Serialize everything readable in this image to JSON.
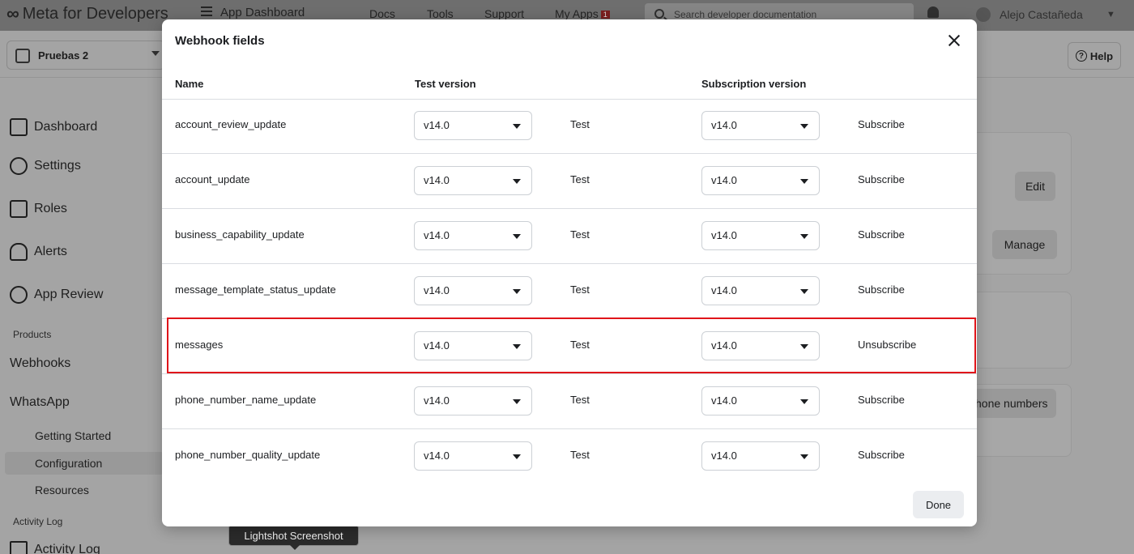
{
  "topbar": {
    "brand": "Meta for Developers",
    "app_dashboard": "App Dashboard",
    "nav": [
      "Docs",
      "Tools",
      "Support",
      "My Apps"
    ],
    "my_apps_badge": "1",
    "search_placeholder": "Search developer documentation",
    "user_name": "Alejo Castañeda"
  },
  "subbar": {
    "app_name": "Pruebas 2",
    "help_label": "Help"
  },
  "sidebar": {
    "items": [
      {
        "label": "Dashboard",
        "icon": "home-icon"
      },
      {
        "label": "Settings",
        "icon": "gear-icon"
      },
      {
        "label": "Roles",
        "icon": "roles-icon"
      },
      {
        "label": "Alerts",
        "icon": "bell-icon"
      },
      {
        "label": "App Review",
        "icon": "shield-check-icon"
      }
    ],
    "products_label": "Products",
    "webhooks": "Webhooks",
    "whatsapp": "WhatsApp",
    "sub_items": [
      "Getting Started",
      "Configuration",
      "Resources"
    ],
    "activity_section": "Activity Log",
    "activity_item": "Activity Log"
  },
  "background": {
    "edit_label": "Edit",
    "manage_label": "Manage",
    "phone_numbers_label": "hone numbers"
  },
  "modal": {
    "title": "Webhook fields",
    "columns": {
      "name": "Name",
      "test_version": "Test version",
      "subscription_version": "Subscription version"
    },
    "rows": [
      {
        "name": "account_review_update",
        "test_version": "v14.0",
        "test_label": "Test",
        "subscription_version": "v14.0",
        "action": "Subscribe"
      },
      {
        "name": "account_update",
        "test_version": "v14.0",
        "test_label": "Test",
        "subscription_version": "v14.0",
        "action": "Subscribe"
      },
      {
        "name": "business_capability_update",
        "test_version": "v14.0",
        "test_label": "Test",
        "subscription_version": "v14.0",
        "action": "Subscribe"
      },
      {
        "name": "message_template_status_update",
        "test_version": "v14.0",
        "test_label": "Test",
        "subscription_version": "v14.0",
        "action": "Subscribe"
      },
      {
        "name": "messages",
        "test_version": "v14.0",
        "test_label": "Test",
        "subscription_version": "v14.0",
        "action": "Unsubscribe"
      },
      {
        "name": "phone_number_name_update",
        "test_version": "v14.0",
        "test_label": "Test",
        "subscription_version": "v14.0",
        "action": "Subscribe"
      },
      {
        "name": "phone_number_quality_update",
        "test_version": "v14.0",
        "test_label": "Test",
        "subscription_version": "v14.0",
        "action": "Subscribe"
      }
    ],
    "done_label": "Done",
    "highlight_color": "#e0151a"
  },
  "tooltip": "Lightshot Screenshot"
}
